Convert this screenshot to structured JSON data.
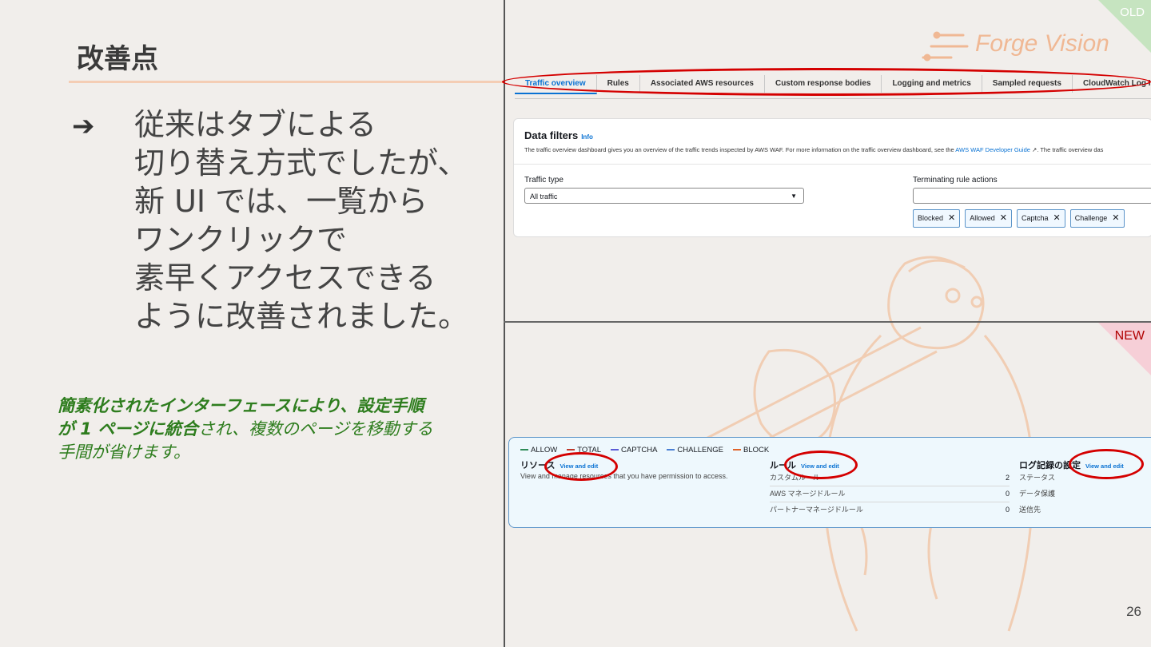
{
  "slide": {
    "title": "改善点",
    "bullet_text": "従来はタブによる\n切り替え方式でしたが、\n新 UI では、一覧から\nワンクリックで\n素早くアクセスできる\nように改善されました。",
    "note_bold_1": "簡素化されたインターフェースにより、設定手順が 1 ページに統合",
    "note_rest": "され、複数のページを移動する手間が省けます。",
    "page_number": "26",
    "label_old": "OLD",
    "label_new": "NEW",
    "logo_text": "Forge Vision"
  },
  "old_ui": {
    "tabs": [
      "Traffic overview",
      "Rules",
      "Associated AWS resources",
      "Custom response bodies",
      "Logging and metrics",
      "Sampled requests",
      "CloudWatch Log Insights"
    ],
    "card_title": "Data filters",
    "info_link": "Info",
    "desc_prefix": "The traffic overview dashboard gives you an overview of the traffic trends inspected by AWS WAF. For more information on the traffic overview dashboard, see the ",
    "desc_link": "AWS WAF Developer Guide",
    "desc_suffix": ". The traffic overview das",
    "traffic_type_label": "Traffic type",
    "traffic_type_value": "All traffic",
    "terminating_label": "Terminating rule actions",
    "chips": [
      "Blocked",
      "Allowed",
      "Captcha",
      "Challenge"
    ]
  },
  "new_ui": {
    "legend": [
      {
        "label": "ALLOW",
        "color": "#2e8b57"
      },
      {
        "label": "TOTAL",
        "color": "#c0392b"
      },
      {
        "label": "CAPTCHA",
        "color": "#5b5bd6"
      },
      {
        "label": "CHALLENGE",
        "color": "#4a7fd4"
      },
      {
        "label": "BLOCK",
        "color": "#e0632a"
      }
    ],
    "resources_title": "リソース",
    "resources_desc": "View and manage resources that you have permission to access.",
    "rules_title": "ルール",
    "log_title": "ログ記録の設定",
    "view_and_edit": "View and edit",
    "rules": [
      {
        "name": "カスタムルール",
        "count": "2"
      },
      {
        "name": "AWS マネージドルール",
        "count": "0"
      },
      {
        "name": "パートナーマネージドルール",
        "count": "0"
      }
    ],
    "log_items": [
      "ステータス",
      "データ保護",
      "送信先"
    ]
  },
  "colors": {
    "accent_red": "#d40000",
    "note_green": "#2e7d1e",
    "aws_blue": "#0972d3",
    "peach": "#f0b894"
  }
}
